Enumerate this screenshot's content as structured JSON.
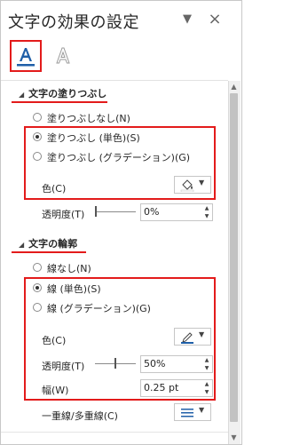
{
  "pane": {
    "title": "文字の効果の設定",
    "dropdown_icon": "chevron-down-icon",
    "close_icon": "close-icon"
  },
  "tabs": {
    "fill_tab_icon": "text-fill-A-icon",
    "effects_tab_icon": "text-outline-A-icon"
  },
  "fill": {
    "header": "文字の塗りつぶし",
    "options": [
      {
        "label": "塗りつぶしなし(N)",
        "selected": false
      },
      {
        "label": "塗りつぶし (単色)(S)",
        "selected": true
      },
      {
        "label": "塗りつぶし (グラデーション)(G)",
        "selected": false
      }
    ],
    "color_label": "色(C)",
    "transparency_label": "透明度(T)",
    "transparency_value": "0%",
    "transparency_level": 0
  },
  "outline": {
    "header": "文字の輪郭",
    "options": [
      {
        "label": "線なし(N)",
        "selected": false
      },
      {
        "label": "線 (単色)(S)",
        "selected": true
      },
      {
        "label": "線 (グラデーション)(G)",
        "selected": false
      }
    ],
    "color_label": "色(C)",
    "transparency_label": "透明度(T)",
    "transparency_value": "50%",
    "transparency_level": 0.5,
    "width_label": "幅(W)",
    "width_value": "0.25 pt",
    "compound_label": "一重線/多重線(C)"
  },
  "colors": {
    "highlight": "#e31b1b",
    "accent": "#1f5fa8"
  }
}
